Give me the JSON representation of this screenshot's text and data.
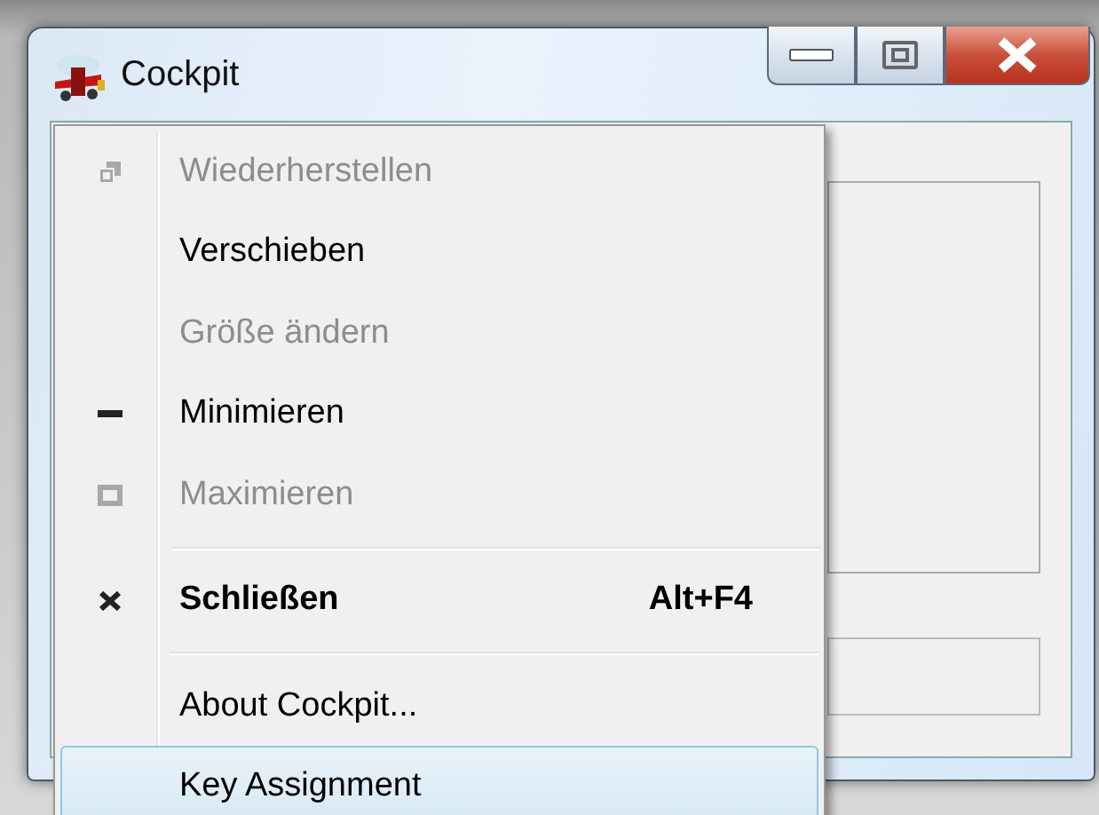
{
  "window": {
    "title": "Cockpit"
  },
  "menu": [
    {
      "kind": "restore",
      "label": "Wiederherstellen",
      "disabled": true,
      "selected": false
    },
    {
      "kind": "plain",
      "label": "Verschieben",
      "disabled": false,
      "selected": false
    },
    {
      "kind": "plain",
      "label": "Größe ändern",
      "disabled": true,
      "selected": false
    },
    {
      "kind": "minimize",
      "label": "Minimieren",
      "disabled": false,
      "selected": false
    },
    {
      "kind": "maximize",
      "label": "Maximieren",
      "disabled": true,
      "selected": false
    },
    {
      "kind": "separator"
    },
    {
      "kind": "close",
      "label": "Schließen",
      "shortcut": "Alt+F4",
      "default": true,
      "disabled": false,
      "selected": false
    },
    {
      "kind": "separator"
    },
    {
      "kind": "plain",
      "label": "About Cockpit...",
      "disabled": false,
      "selected": false
    },
    {
      "kind": "plain",
      "label": "Key Assignment",
      "disabled": false,
      "selected": true
    }
  ]
}
